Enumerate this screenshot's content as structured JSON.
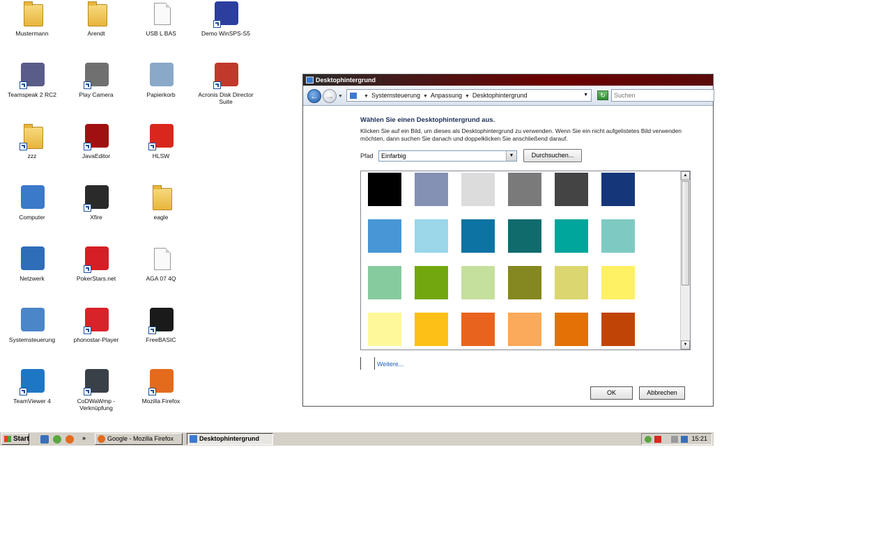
{
  "desktop_icons": [
    {
      "name": "mustermann-folder",
      "label": "Mustermann",
      "kind": "folder",
      "shortcut": false
    },
    {
      "name": "arendt-folder",
      "label": "Arendt",
      "kind": "folder",
      "shortcut": false
    },
    {
      "name": "usbl-bas-file",
      "label": "USB L BAS",
      "kind": "file",
      "shortcut": false
    },
    {
      "name": "demo-winsps-icon",
      "label": "Demo WinSPS-S5",
      "kind": "app",
      "color": "#2c3e9e",
      "shortcut": true
    },
    {
      "name": "teamspeak-icon",
      "label": "Teamspeak 2 RC2",
      "kind": "app",
      "color": "#5a5c8a",
      "shortcut": true
    },
    {
      "name": "play-camera-icon",
      "label": "Play Camera",
      "kind": "app",
      "color": "#707070",
      "shortcut": true
    },
    {
      "name": "papierkorb-icon",
      "label": "Papierkorb",
      "kind": "app",
      "color": "#8aa8c8",
      "shortcut": false
    },
    {
      "name": "acronis-icon",
      "label": "Acronis Disk Director Suite",
      "kind": "app",
      "color": "#c0392b",
      "shortcut": true
    },
    {
      "name": "zzz-icon",
      "label": "zzz",
      "kind": "folder",
      "shortcut": true
    },
    {
      "name": "javaeditor-icon",
      "label": "JavaEditor",
      "kind": "app",
      "color": "#a01010",
      "shortcut": true
    },
    {
      "name": "hlsw-icon",
      "label": "HLSW",
      "kind": "app",
      "color": "#d9271e",
      "shortcut": true
    },
    {
      "name": "computer-icon",
      "label": "Computer",
      "kind": "app",
      "color": "#3b79c9",
      "shortcut": false
    },
    {
      "name": "xfire-icon",
      "label": "Xfire",
      "kind": "app",
      "color": "#2a2a2a",
      "shortcut": true
    },
    {
      "name": "eagle-folder",
      "label": "eagle",
      "kind": "folder",
      "shortcut": false
    },
    {
      "name": "netzwerk-icon",
      "label": "Netzwerk",
      "kind": "app",
      "color": "#2f6db8",
      "shortcut": false
    },
    {
      "name": "pokerstars-icon",
      "label": "PokerStars.net",
      "kind": "app",
      "color": "#d51e25",
      "shortcut": true
    },
    {
      "name": "aga-file",
      "label": "AGA 07 4Q",
      "kind": "file",
      "shortcut": false
    },
    {
      "name": "systemsteuerung-icon",
      "label": "Systemsteuerung",
      "kind": "app",
      "color": "#4b86c8",
      "shortcut": false
    },
    {
      "name": "phonostar-icon",
      "label": "phonostar-Player",
      "kind": "app",
      "color": "#d8232a",
      "shortcut": true
    },
    {
      "name": "freebasic-icon",
      "label": "FreeBASIC",
      "kind": "app",
      "color": "#1a1a1a",
      "shortcut": true
    },
    {
      "name": "teamviewer-icon",
      "label": "TeamViewer 4",
      "kind": "app",
      "color": "#1e77c5",
      "shortcut": true
    },
    {
      "name": "codwawmp-icon",
      "label": "CoDWaWmp - Verknüpfung",
      "kind": "app",
      "color": "#3a4048",
      "shortcut": true
    },
    {
      "name": "firefox-icon",
      "label": "Mozilla Firefox",
      "kind": "app",
      "color": "#e46b1c",
      "shortcut": true
    }
  ],
  "window": {
    "title": "Desktophintergrund",
    "breadcrumb": [
      "Systemsteuerung",
      "Anpassung",
      "Desktophintergrund"
    ],
    "search_placeholder": "Suchen",
    "heading": "Wählen Sie einen Desktophintergrund aus.",
    "description": "Klicken Sie auf ein Bild, um dieses als Desktophintergrund zu verwenden. Wenn Sie ein nicht aufgelistetes Bild verwenden möchten, dann suchen Sie danach und doppelklicken Sie anschließend darauf.",
    "path_label": "Pfad",
    "path_value": "Einfarbig",
    "browse_label": "Durchsuchen...",
    "more_link": "Weitere...",
    "ok_label": "OK",
    "cancel_label": "Abbrechen",
    "swatches": [
      "#000000",
      "#8491b4",
      "#dcdcdc",
      "#7a7a7a",
      "#444444",
      "#15377a",
      "#4896d6",
      "#9bd6e9",
      "#0d73a3",
      "#106b6d",
      "#00a59b",
      "#7ecac3",
      "#86cb9e",
      "#73a70f",
      "#c5df9c",
      "#858720",
      "#dbd66f",
      "#fff064",
      "#fff89a",
      "#fdc016",
      "#e8641e",
      "#fba95b",
      "#e47105",
      "#c14407"
    ]
  },
  "taskbar": {
    "start_label": "Start",
    "tasks": [
      "Google - Mozilla Firefox",
      "Desktophintergrund"
    ],
    "clock": "15:21"
  }
}
